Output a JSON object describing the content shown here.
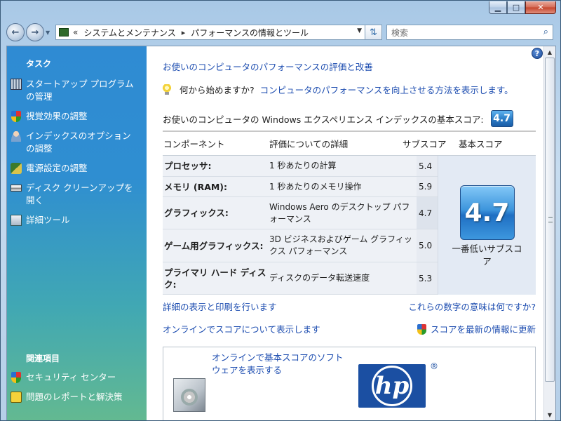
{
  "window": {
    "minimize_icon": "minimize-icon",
    "maximize_icon": "maximize-icon",
    "close_icon": "close-icon"
  },
  "address": {
    "chevron": "«",
    "crumb1": "システムとメンテナンス",
    "crumb2": "パフォーマンスの情報とツール"
  },
  "search": {
    "placeholder": "検索"
  },
  "sidebar": {
    "tasks_heading": "タスク",
    "tasks": [
      {
        "label": "スタートアップ プログラムの管理",
        "icon": "startup-programs-icon"
      },
      {
        "label": "視覚効果の調整",
        "icon": "security-shield-icon"
      },
      {
        "label": "インデックスのオプションの調整",
        "icon": "indexing-icon"
      },
      {
        "label": "電源設定の調整",
        "icon": "power-options-icon"
      },
      {
        "label": "ディスク クリーンアップを開く",
        "icon": "disk-cleanup-icon"
      },
      {
        "label": "詳細ツール",
        "icon": "advanced-tools-icon"
      }
    ],
    "related_heading": "関連項目",
    "related": [
      {
        "label": "セキュリティ センター",
        "icon": "security-center-icon"
      },
      {
        "label": "問題のレポートと解決策",
        "icon": "problem-reports-icon"
      }
    ]
  },
  "main": {
    "title": "お使いのコンピュータのパフォーマンスの評価と改善",
    "tip_question": "何から始めますか?",
    "tip_link": "コンピュータのパフォーマンスを向上させる方法を表示します。",
    "base_label": "お使いのコンピュータの Windows エクスペリエンス インデックスの基本スコア:",
    "base_score": "4.7",
    "table": {
      "headers": [
        "コンポーネント",
        "評価についての詳細",
        "サブスコア",
        "基本スコア"
      ],
      "rows": [
        {
          "component": "プロセッサ:",
          "detail": "1 秒あたりの計算",
          "subscore": "5.4"
        },
        {
          "component": "メモリ (RAM):",
          "detail": "1 秒あたりのメモリ操作",
          "subscore": "5.9"
        },
        {
          "component": "グラフィックス:",
          "detail": "Windows Aero のデスクトップ パフォーマンス",
          "subscore": "4.7"
        },
        {
          "component": "ゲーム用グラフィックス:",
          "detail": "3D ビジネスおよびゲーム グラフィックス パフォーマンス",
          "subscore": "5.0"
        },
        {
          "component": "プライマリ ハード ディスク:",
          "detail": "ディスクのデータ転送速度",
          "subscore": "5.3"
        }
      ],
      "base_big": "4.7",
      "base_caption": "一番低いサブスコア"
    },
    "link_print": "詳細の表示と印刷を行います",
    "link_meaning": "これらの数字の意味は何ですか?",
    "link_online": "オンラインでスコアについて表示します",
    "link_update": "スコアを最新の情報に更新",
    "oem_link": "オンラインで基本スコアのソフトウェアを表示する",
    "oem_logo_text": "hp",
    "oem_reg": "®"
  }
}
